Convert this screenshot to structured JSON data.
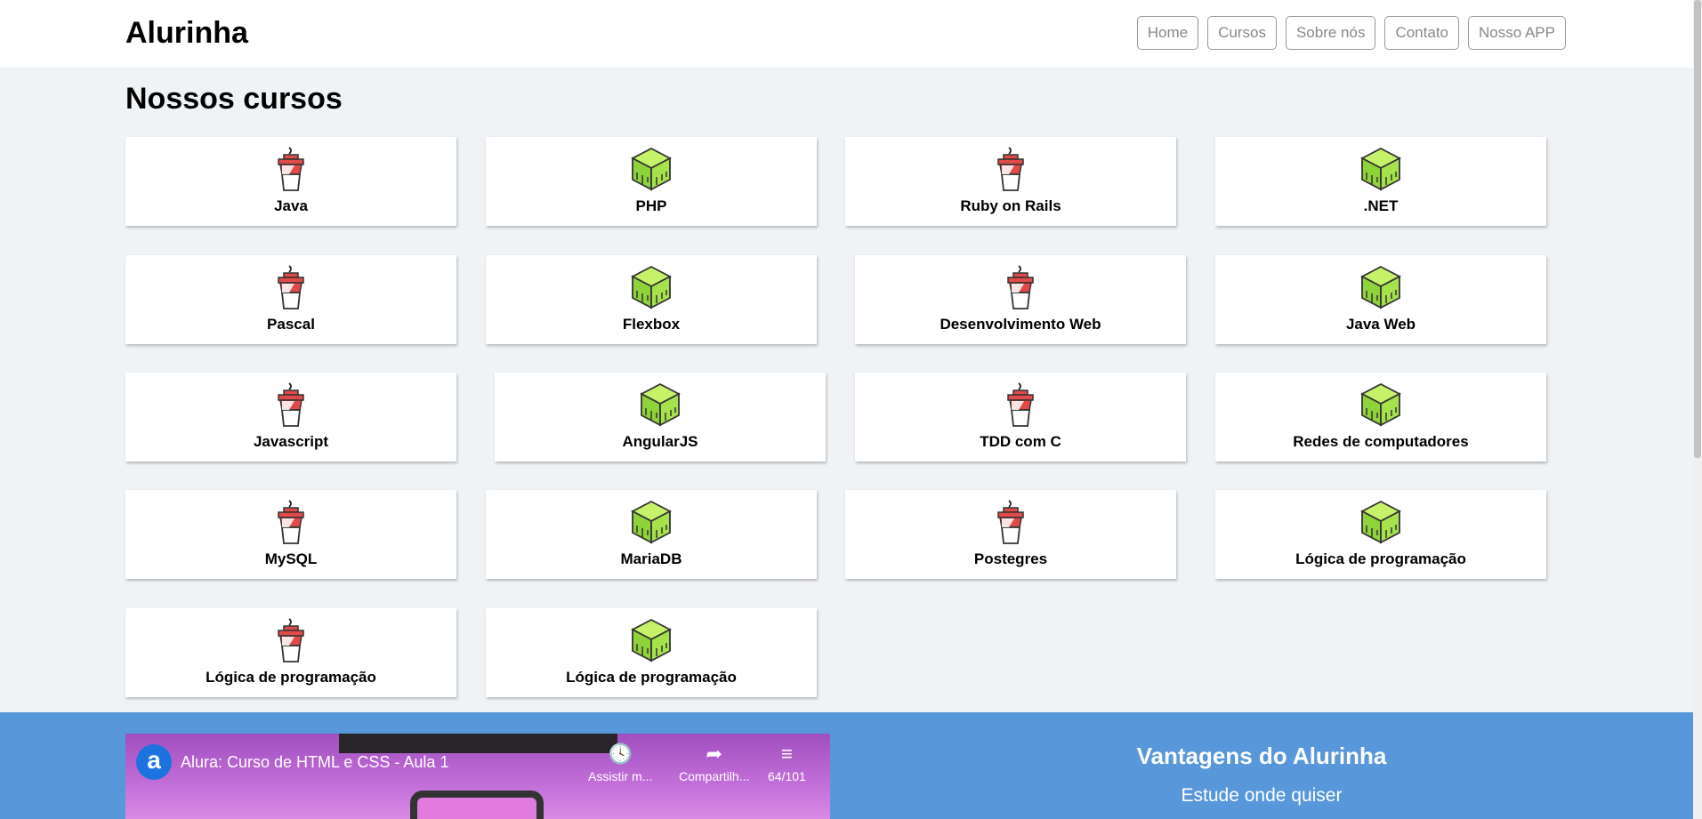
{
  "header": {
    "logo": "Alurinha",
    "nav": [
      "Home",
      "Cursos",
      "Sobre nós",
      "Contato",
      "Nosso APP"
    ]
  },
  "main": {
    "title": "Nossos cursos",
    "courses": [
      {
        "name": "Java",
        "icon": "coffee-cup-icon"
      },
      {
        "name": "PHP",
        "icon": "green-cube-icon"
      },
      {
        "name": "Ruby on Rails",
        "icon": "coffee-cup-icon"
      },
      {
        "name": ".NET",
        "icon": "green-cube-icon"
      },
      {
        "name": "Pascal",
        "icon": "coffee-cup-icon"
      },
      {
        "name": "Flexbox",
        "icon": "green-cube-icon"
      },
      {
        "name": "Desenvolvimento Web",
        "icon": "coffee-cup-icon"
      },
      {
        "name": "Java Web",
        "icon": "green-cube-icon"
      },
      {
        "name": "Javascript",
        "icon": "coffee-cup-icon"
      },
      {
        "name": "AngularJS",
        "icon": "green-cube-icon"
      },
      {
        "name": "TDD com C",
        "icon": "coffee-cup-icon"
      },
      {
        "name": "Redes de computadores",
        "icon": "green-cube-icon"
      },
      {
        "name": "MySQL",
        "icon": "coffee-cup-icon"
      },
      {
        "name": "MariaDB",
        "icon": "green-cube-icon"
      },
      {
        "name": "Postegres",
        "icon": "coffee-cup-icon"
      },
      {
        "name": "Lógica de programação",
        "icon": "green-cube-icon"
      },
      {
        "name": "Lógica de programação",
        "icon": "coffee-cup-icon"
      },
      {
        "name": "Lógica de programação",
        "icon": "green-cube-icon"
      }
    ]
  },
  "video": {
    "logo_letter": "a",
    "title": "Alura: Curso de HTML e CSS - Aula 1",
    "watch_later": "Assistir m...",
    "share": "Compartilh...",
    "playlist": "64/101"
  },
  "advantages": {
    "title": "Vantagens do Alurinha",
    "subtitle": "Estude onde quiser"
  },
  "colors": {
    "background": "#f0f3f6",
    "footer_blue": "#5897d9",
    "cup_red": "#e24a4a",
    "cube_green": "#9fe04a"
  }
}
